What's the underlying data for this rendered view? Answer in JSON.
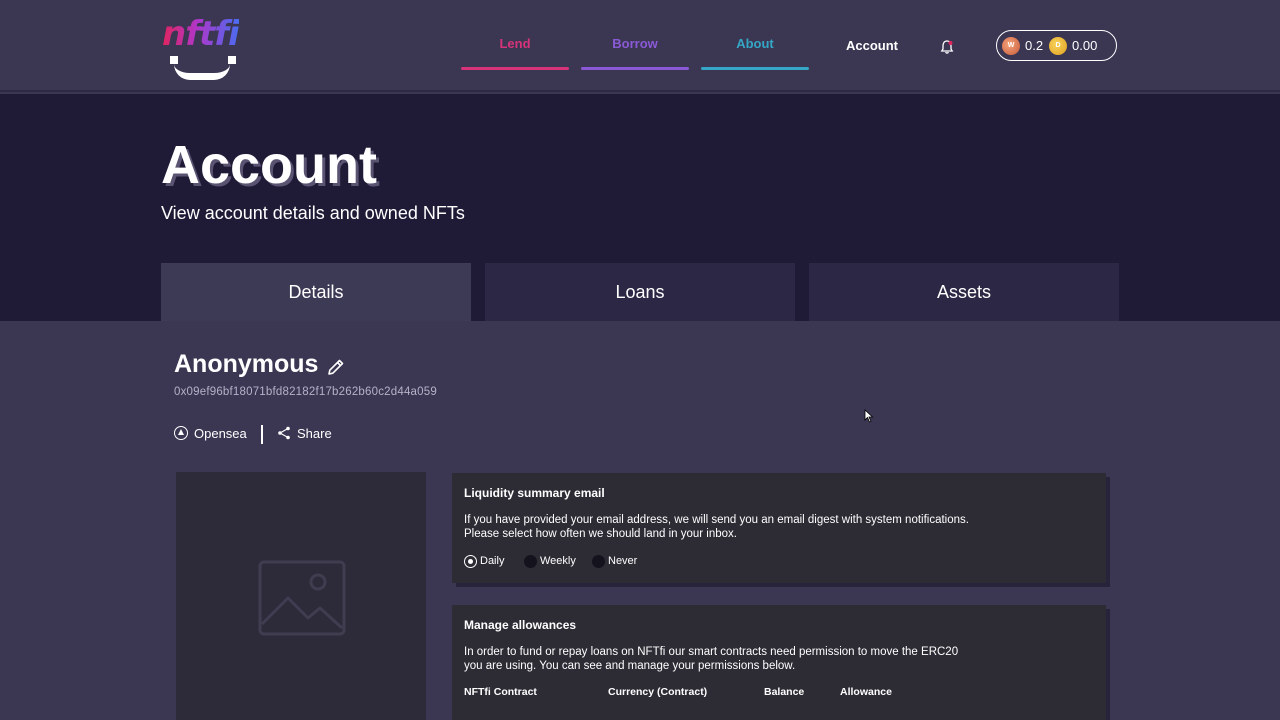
{
  "header": {
    "logo_text": "nftfi",
    "nav": {
      "lend": "Lend",
      "borrow": "Borrow",
      "about": "About",
      "account": "Account"
    },
    "wallet": {
      "weth_balance": "0.2",
      "dai_balance": "0.00",
      "weth_icon": "weth-coin-icon",
      "dai_icon": "dai-coin-icon"
    }
  },
  "hero": {
    "title": "Account",
    "subtitle": "View account details and owned NFTs"
  },
  "tabs": [
    {
      "label": "Details"
    },
    {
      "label": "Loans"
    },
    {
      "label": "Assets"
    }
  ],
  "profile": {
    "name": "Anonymous",
    "address": "0x09ef96bf18071bfd82182f17b262b60c2d44a059",
    "opensea_label": "Opensea",
    "share_label": "Share"
  },
  "email_panel": {
    "title": "Liquidity summary email",
    "text_line1": "If you have provided your email address, we will send you an email digest with system notifications.",
    "text_line2": "Please select how often we should land in your inbox.",
    "options": [
      {
        "label": "Daily",
        "selected": true
      },
      {
        "label": "Weekly",
        "selected": false
      },
      {
        "label": "Never",
        "selected": false
      }
    ]
  },
  "allowances_panel": {
    "title": "Manage allowances",
    "text_line1": "In order to fund or repay loans on NFTfi our smart contracts need permission to move the ERC20",
    "text_line2": "you are using. You can see and manage your permissions below.",
    "columns": [
      "NFTfi Contract",
      "Currency (Contract)",
      "Balance",
      "Allowance"
    ]
  },
  "colors": {
    "lend": "#d7337a",
    "borrow": "#8a5ad6",
    "about": "#36a6c6",
    "hero_bg": "#1f1b36",
    "page_bg": "#3b3652"
  }
}
